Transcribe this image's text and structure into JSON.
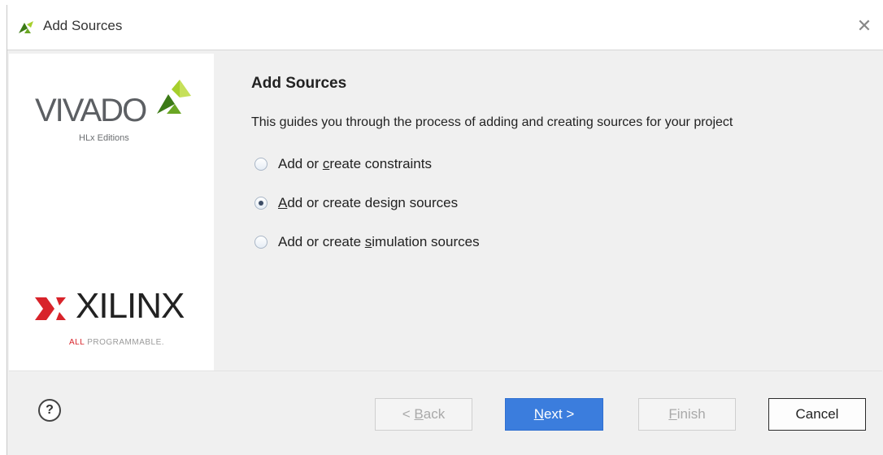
{
  "window": {
    "title": "Add Sources",
    "close_symbol": "✕"
  },
  "branding": {
    "vivado_text": "VIVADO",
    "vivado_subtitle": "HLx Editions",
    "xilinx_text": "XILINX",
    "xilinx_tagline_all": "ALL",
    "xilinx_tagline_rest": " PROGRAMMABLE."
  },
  "content": {
    "heading": "Add Sources",
    "description": "This guides you through the process of adding and creating sources for your project",
    "options": [
      {
        "prefix": "Add or ",
        "mnemonic": "c",
        "suffix": "reate constraints",
        "selected": false
      },
      {
        "prefix": "",
        "mnemonic": "A",
        "suffix": "dd or create design sources",
        "selected": true
      },
      {
        "prefix": "Add or create ",
        "mnemonic": "s",
        "suffix": "imulation sources",
        "selected": false
      }
    ]
  },
  "footer": {
    "help_label": "?",
    "back": {
      "prefix": "< ",
      "mnemonic": "B",
      "suffix": "ack",
      "enabled": false
    },
    "next": {
      "prefix": "",
      "mnemonic": "N",
      "suffix": "ext >",
      "enabled": true
    },
    "finish": {
      "prefix": "",
      "mnemonic": "F",
      "suffix": "inish",
      "enabled": false
    },
    "cancel": {
      "label": "Cancel",
      "enabled": true
    }
  },
  "colors": {
    "primary_button": "#3b7ddd",
    "xilinx_red": "#d8232a",
    "vivado_green_dark": "#3c7a16",
    "vivado_green_light": "#a6cf2c"
  }
}
